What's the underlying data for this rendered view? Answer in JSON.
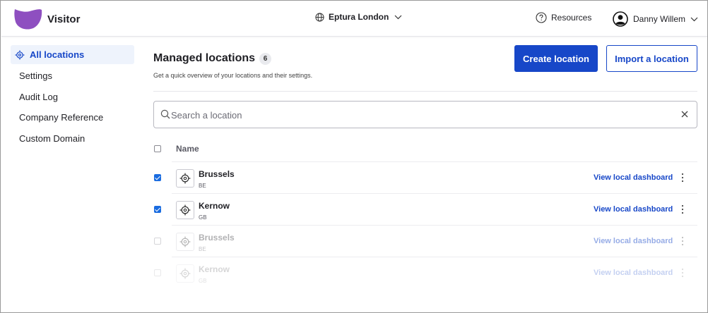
{
  "app": {
    "name": "Visitor",
    "logo_icon": "visitor-logo-icon",
    "brand_color": "#8e4fc0"
  },
  "header": {
    "site": "Eptura London",
    "site_icon": "globe-icon",
    "resources_label": "Resources",
    "resources_icon": "help-circle-icon",
    "user_name": "Danny Willem",
    "user_icon": "user-avatar-icon"
  },
  "sidebar": {
    "items": [
      {
        "label": "All locations",
        "active": true,
        "icon": "location-target-icon"
      },
      {
        "label": "Settings"
      },
      {
        "label": "Audit Log"
      },
      {
        "label": "Company Reference"
      },
      {
        "label": "Custom Domain"
      }
    ]
  },
  "main": {
    "title": "Managed locations",
    "count": "6",
    "subtitle": "Get a quick overview of your locations and their settings.",
    "create_button": "Create location",
    "import_button": "Import a location",
    "search_placeholder": "Search a location",
    "table": {
      "column_name": "Name",
      "rows": [
        {
          "name": "Brussels",
          "code": "BE",
          "checked": true,
          "link": "View local dashboard"
        },
        {
          "name": "Kernow",
          "code": "GB",
          "checked": true,
          "link": "View local dashboard"
        },
        {
          "name": "Brussels",
          "code": "BE",
          "checked": false,
          "link": "View local dashboard"
        },
        {
          "name": "Kernow",
          "code": "GB",
          "checked": false,
          "link": "View local dashboard"
        }
      ]
    }
  },
  "colors": {
    "primary": "#1747c8",
    "active_bg": "#eef3fc",
    "checkbox": "#1a6ce0"
  }
}
